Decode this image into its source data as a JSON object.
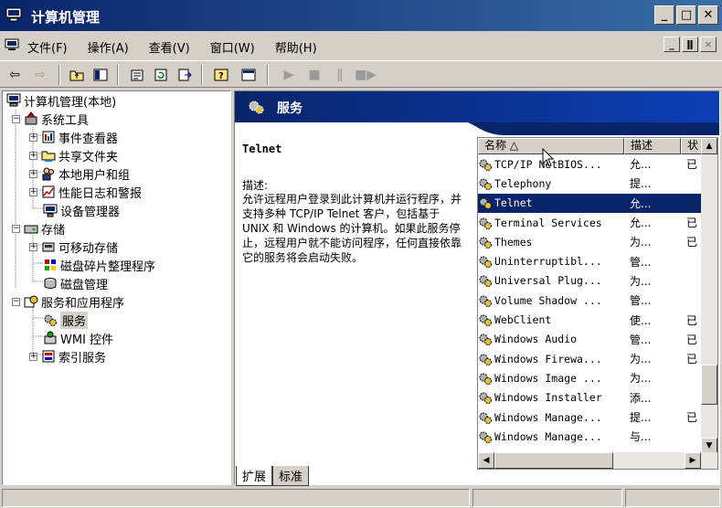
{
  "window": {
    "title": "计算机管理"
  },
  "menu": [
    "文件(F)",
    "操作(A)",
    "查看(V)",
    "窗口(W)",
    "帮助(H)"
  ],
  "mdi_buttons": [
    "_",
    "ǁ",
    "×"
  ],
  "tree": {
    "root": "计算机管理(本地)",
    "system_tools": "系统工具",
    "event_viewer": "事件查看器",
    "shared_folders": "共享文件夹",
    "local_users": "本地用户和组",
    "perf_logs": "性能日志和警报",
    "device_manager": "设备管理器",
    "storage": "存储",
    "removable": "可移动存储",
    "defrag": "磁盘碎片整理程序",
    "disk_mgmt": "磁盘管理",
    "services_apps": "服务和应用程序",
    "services": "服务",
    "wmi": "WMI 控件",
    "indexing": "索引服务"
  },
  "right": {
    "header_title": "服务",
    "service_name": "Telnet",
    "desc_label": "描述:",
    "desc_text": "允许远程用户登录到此计算机并运行程序，并支持多种 TCP/IP Telnet 客户，包括基于 UNIX 和 Windows 的计算机。如果此服务停止，远程用户就不能访问程序，任何直接依靠它的服务将会启动失败。"
  },
  "list": {
    "columns": [
      "名称 △",
      "描述",
      "状"
    ],
    "rows": [
      {
        "name": "TCP/IP NetBIOS...",
        "desc": "允...",
        "status": "已"
      },
      {
        "name": "Telephony",
        "desc": "提...",
        "status": ""
      },
      {
        "name": "Telnet",
        "desc": "允...",
        "status": ""
      },
      {
        "name": "Terminal Services",
        "desc": "允...",
        "status": "已"
      },
      {
        "name": "Themes",
        "desc": "为...",
        "status": "已"
      },
      {
        "name": "Uninterruptibl...",
        "desc": "管...",
        "status": ""
      },
      {
        "name": "Universal Plug...",
        "desc": "为...",
        "status": ""
      },
      {
        "name": "Volume Shadow ...",
        "desc": "管...",
        "status": ""
      },
      {
        "name": "WebClient",
        "desc": "使...",
        "status": "已"
      },
      {
        "name": "Windows Audio",
        "desc": "管...",
        "status": "已"
      },
      {
        "name": "Windows Firewa...",
        "desc": "为...",
        "status": "已"
      },
      {
        "name": "Windows Image ...",
        "desc": "为...",
        "status": ""
      },
      {
        "name": "Windows Installer",
        "desc": "添...",
        "status": ""
      },
      {
        "name": "Windows Manage...",
        "desc": "提...",
        "status": "已"
      },
      {
        "name": "Windows Manage...",
        "desc": "与...",
        "status": ""
      }
    ],
    "selected_index": 2
  },
  "tabs": [
    "扩展",
    "标准"
  ],
  "colors": {
    "title_blue": "#0a246a",
    "selection": "#0a246a",
    "face": "#d4d0c8"
  }
}
